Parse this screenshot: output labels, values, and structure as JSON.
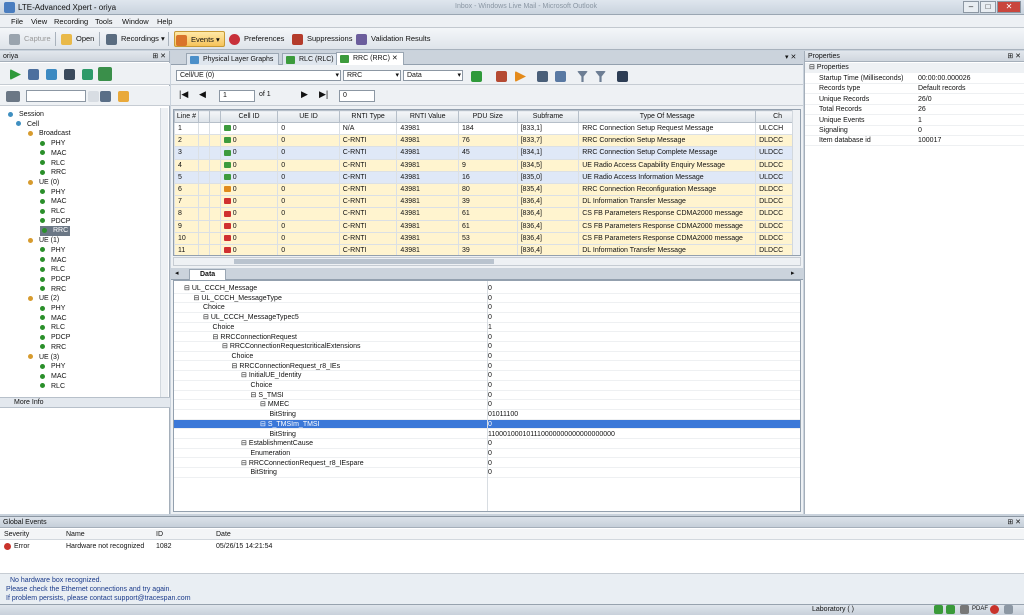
{
  "window": {
    "title": "LTE-Advanced Xpert - oriya",
    "bg_title": "Inbox - Windows Live Mail - Microsoft Outlook"
  },
  "menu": [
    "File",
    "View",
    "Recording",
    "Tools",
    "Window",
    "Help"
  ],
  "toolbar": {
    "capture": "Capture",
    "open": "Open",
    "recordings": "Recordings",
    "events": "Events",
    "preferences": "Preferences",
    "suppressions": "Suppressions",
    "validation": "Validation Results"
  },
  "left_panel": {
    "title": "oriya",
    "page_input": "",
    "more_info": "More Info"
  },
  "tree": [
    {
      "label": "Session",
      "level": 0,
      "kind": "session"
    },
    {
      "label": "Cell",
      "level": 1,
      "kind": "cell"
    },
    {
      "label": "Broadcast",
      "level": 2,
      "kind": "folder"
    },
    {
      "label": "PHY",
      "level": 3,
      "kind": "leaf"
    },
    {
      "label": "MAC",
      "level": 3,
      "kind": "leaf"
    },
    {
      "label": "RLC",
      "level": 3,
      "kind": "leaf"
    },
    {
      "label": "RRC",
      "level": 3,
      "kind": "leaf"
    },
    {
      "label": "UE (0)",
      "level": 2,
      "kind": "ue"
    },
    {
      "label": "PHY",
      "level": 3,
      "kind": "leaf"
    },
    {
      "label": "MAC",
      "level": 3,
      "kind": "leaf"
    },
    {
      "label": "RLC",
      "level": 3,
      "kind": "leaf"
    },
    {
      "label": "PDCP",
      "level": 3,
      "kind": "leaf"
    },
    {
      "label": "RRC",
      "level": 3,
      "kind": "leaf",
      "selected": true
    },
    {
      "label": "UE (1)",
      "level": 2,
      "kind": "ue"
    },
    {
      "label": "PHY",
      "level": 3,
      "kind": "leaf"
    },
    {
      "label": "MAC",
      "level": 3,
      "kind": "leaf"
    },
    {
      "label": "RLC",
      "level": 3,
      "kind": "leaf"
    },
    {
      "label": "PDCP",
      "level": 3,
      "kind": "leaf"
    },
    {
      "label": "RRC",
      "level": 3,
      "kind": "leaf"
    },
    {
      "label": "UE (2)",
      "level": 2,
      "kind": "ue"
    },
    {
      "label": "PHY",
      "level": 3,
      "kind": "leaf"
    },
    {
      "label": "MAC",
      "level": 3,
      "kind": "leaf"
    },
    {
      "label": "RLC",
      "level": 3,
      "kind": "leaf"
    },
    {
      "label": "PDCP",
      "level": 3,
      "kind": "leaf"
    },
    {
      "label": "RRC",
      "level": 3,
      "kind": "leaf"
    },
    {
      "label": "UE (3)",
      "level": 2,
      "kind": "ue"
    },
    {
      "label": "PHY",
      "level": 3,
      "kind": "leaf"
    },
    {
      "label": "MAC",
      "level": 3,
      "kind": "leaf"
    },
    {
      "label": "RLC",
      "level": 3,
      "kind": "leaf"
    }
  ],
  "tabs": [
    "Physical Layer Graphs",
    "RLC (RLC)",
    "RRC (RRC)"
  ],
  "filters": {
    "field1": "Cell/UE (0)",
    "field2": "RRC",
    "field3": "Data"
  },
  "nav": {
    "page": "1",
    "of": "of 1",
    "find": "0"
  },
  "grid": {
    "columns": [
      "Line #",
      "",
      "",
      "Cell ID",
      "UE ID",
      "RNTI Type",
      "RNTI Value",
      "PDU Size",
      "Subframe",
      "Type Of Message",
      "Ch"
    ],
    "rows": [
      {
        "line": "1",
        "cell": "0",
        "ue": "0",
        "rnti_type": "N/A",
        "rnti": "43981",
        "pdu": "184",
        "sf": "[833,1]",
        "msg": "RRC Connection Setup Request Message",
        "ch": "ULCCH",
        "style": "sel",
        "icon": "#3d9b3d"
      },
      {
        "line": "2",
        "cell": "0",
        "ue": "0",
        "rnti_type": "C-RNTI",
        "rnti": "43981",
        "pdu": "76",
        "sf": "[833,7]",
        "msg": "RRC Connection Setup Message",
        "ch": "DLDCC",
        "style": "y",
        "icon": "#3d9b3d"
      },
      {
        "line": "3",
        "cell": "0",
        "ue": "0",
        "rnti_type": "C-RNTI",
        "rnti": "43981",
        "pdu": "45",
        "sf": "[834,1]",
        "msg": "RRC Connection Setup Complete Message",
        "ch": "ULDCC",
        "style": "b",
        "icon": "#3d9b3d"
      },
      {
        "line": "4",
        "cell": "0",
        "ue": "0",
        "rnti_type": "C-RNTI",
        "rnti": "43981",
        "pdu": "9",
        "sf": "[834,5]",
        "msg": "UE Radio Access Capability Enquiry Message",
        "ch": "DLDCC",
        "style": "y",
        "icon": "#3d9b3d"
      },
      {
        "line": "5",
        "cell": "0",
        "ue": "0",
        "rnti_type": "C-RNTI",
        "rnti": "43981",
        "pdu": "16",
        "sf": "[835,0]",
        "msg": "UE Radio Access Information Message",
        "ch": "ULDCC",
        "style": "b",
        "icon": "#3d9b3d"
      },
      {
        "line": "6",
        "cell": "0",
        "ue": "0",
        "rnti_type": "C-RNTI",
        "rnti": "43981",
        "pdu": "80",
        "sf": "[835,4]",
        "msg": "RRC Connection Reconfiguration Message",
        "ch": "DLDCC",
        "style": "y",
        "icon": "#e08a1c"
      },
      {
        "line": "7",
        "cell": "0",
        "ue": "0",
        "rnti_type": "C-RNTI",
        "rnti": "43981",
        "pdu": "39",
        "sf": "[836,4]",
        "msg": "DL Information Transfer Message",
        "ch": "DLDCC",
        "style": "y",
        "icon": "#d03030"
      },
      {
        "line": "8",
        "cell": "0",
        "ue": "0",
        "rnti_type": "C-RNTI",
        "rnti": "43981",
        "pdu": "61",
        "sf": "[836,4]",
        "msg": "CS FB Parameters Response CDMA2000 message",
        "ch": "DLDCC",
        "style": "y",
        "icon": "#d03030"
      },
      {
        "line": "9",
        "cell": "0",
        "ue": "0",
        "rnti_type": "C-RNTI",
        "rnti": "43981",
        "pdu": "61",
        "sf": "[836,4]",
        "msg": "CS FB Parameters Response CDMA2000 message",
        "ch": "DLDCC",
        "style": "y",
        "icon": "#d03030"
      },
      {
        "line": "10",
        "cell": "0",
        "ue": "0",
        "rnti_type": "C-RNTI",
        "rnti": "43981",
        "pdu": "53",
        "sf": "[836,4]",
        "msg": "CS FB Parameters Response CDMA2000 message",
        "ch": "DLDCC",
        "style": "y",
        "icon": "#d03030"
      },
      {
        "line": "11",
        "cell": "0",
        "ue": "0",
        "rnti_type": "C-RNTI",
        "rnti": "43981",
        "pdu": "39",
        "sf": "[836,4]",
        "msg": "DL Information Transfer Message",
        "ch": "DLDCC",
        "style": "y",
        "icon": "#d03030"
      }
    ]
  },
  "data_tab": "Data",
  "decode": [
    {
      "name": "UL_CCCH_Message",
      "value": "0",
      "lvl": 0,
      "exp": true
    },
    {
      "name": "UL_CCCH_MessageType",
      "value": "0",
      "lvl": 1,
      "exp": true
    },
    {
      "name": "Choice",
      "value": "0",
      "lvl": 2
    },
    {
      "name": "UL_CCCH_MessageTypec5",
      "value": "0",
      "lvl": 2,
      "exp": true
    },
    {
      "name": "Choice",
      "value": "1",
      "lvl": 3
    },
    {
      "name": "RRCConnectionRequest",
      "value": "0",
      "lvl": 3,
      "exp": true
    },
    {
      "name": "RRCConnectionRequestcriticalExtensions",
      "value": "0",
      "lvl": 4,
      "exp": true
    },
    {
      "name": "Choice",
      "value": "0",
      "lvl": 5
    },
    {
      "name": "RRCConnectionRequest_r8_IEs",
      "value": "0",
      "lvl": 5,
      "exp": true
    },
    {
      "name": "InitialUE_Identity",
      "value": "0",
      "lvl": 6,
      "exp": true
    },
    {
      "name": "Choice",
      "value": "0",
      "lvl": 7
    },
    {
      "name": "S_TMSI",
      "value": "0",
      "lvl": 7,
      "exp": true
    },
    {
      "name": "MMEC",
      "value": "0",
      "lvl": 8,
      "exp": true
    },
    {
      "name": "BitString",
      "value": "01011100",
      "lvl": 9
    },
    {
      "name": "S_TMSIm_TMSI",
      "value": "0",
      "lvl": 8,
      "exp": true,
      "hl": true
    },
    {
      "name": "BitString",
      "value": "110001000101110000000000000000000",
      "lvl": 9
    },
    {
      "name": "EstablishmentCause",
      "value": "0",
      "lvl": 6,
      "exp": true
    },
    {
      "name": "Enumeration",
      "value": "0",
      "lvl": 7
    },
    {
      "name": "RRCConnectionRequest_r8_IEspare",
      "value": "0",
      "lvl": 6,
      "exp": true
    },
    {
      "name": "BitString",
      "value": "0",
      "lvl": 7
    }
  ],
  "properties": {
    "title": "Properties",
    "group": "Properties",
    "items": [
      {
        "k": "Startup Time (Milliseconds)",
        "v": "00:00:00.000026"
      },
      {
        "k": "Records type",
        "v": "Default records"
      },
      {
        "k": "Unique Records",
        "v": "26/0"
      },
      {
        "k": "Total Records",
        "v": "26"
      },
      {
        "k": "Unique Events",
        "v": "1"
      },
      {
        "k": "Signaling",
        "v": "0"
      },
      {
        "k": "Item database id",
        "v": "100017"
      }
    ]
  },
  "events": {
    "title": "Global Events",
    "columns": [
      "Severity",
      "Name",
      "ID",
      "Date"
    ],
    "row": {
      "severity": "Error",
      "name": "Hardware not recognized",
      "id": "1082",
      "date": "05/26/15 14:21:54"
    },
    "message": [
      "No hardware box recognized.",
      "Please check the Ethernet connections and try again.",
      "If problem persists, please contact support@tracespan.com"
    ]
  },
  "status": {
    "mode": "Laboratory ( )",
    "badge": "PDAF"
  }
}
